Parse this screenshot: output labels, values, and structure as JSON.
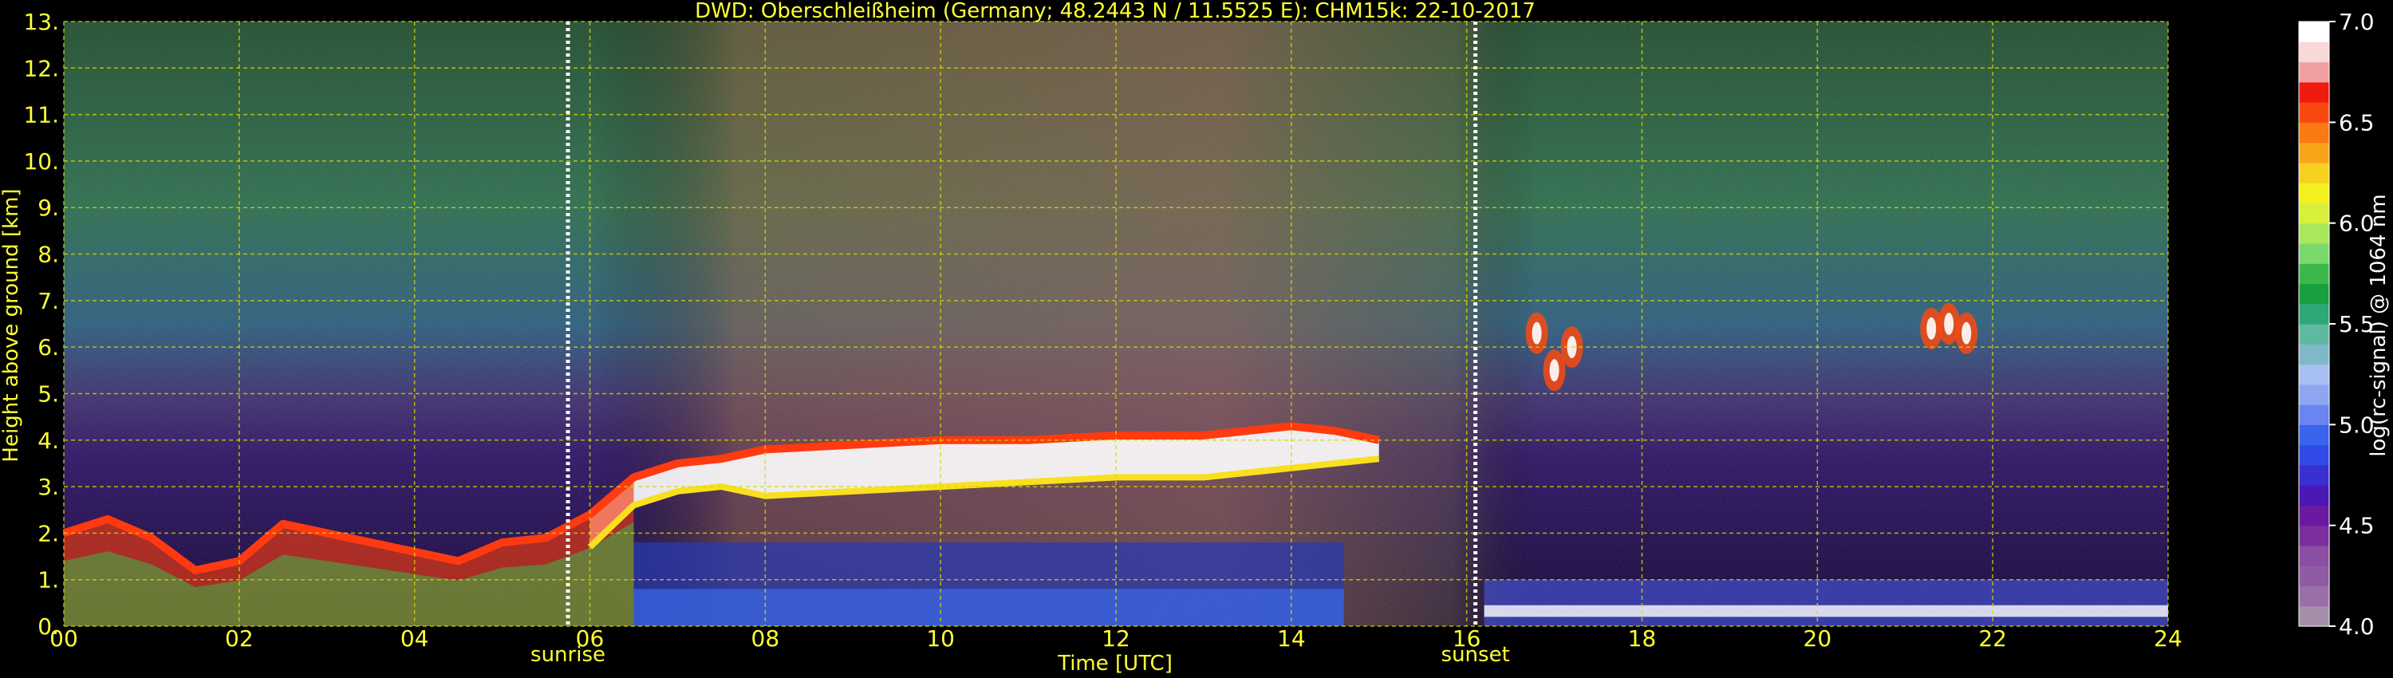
{
  "title": "DWD: Oberschleißheim (Germany; 48.2443 N / 11.5525 E):    CHM15k: 22-10-2017",
  "colors": {
    "background": "#000000",
    "text": "#ffff33",
    "grid": "#d8d800",
    "marker": "#ffffff",
    "colorbar_text": "#ffffff"
  },
  "chart_data": {
    "type": "heatmap",
    "title": "DWD: Oberschleißheim (Germany; 48.2443 N / 11.5525 E):    CHM15k: 22-10-2017",
    "xlabel": "Time [UTC]",
    "ylabel": "Height above ground [km]",
    "xlim": [
      0,
      24
    ],
    "ylim": [
      0,
      13
    ],
    "x_ticks": [
      "00",
      "02",
      "04",
      "06",
      "08",
      "10",
      "12",
      "14",
      "16",
      "18",
      "20",
      "22",
      "24"
    ],
    "y_ticks": [
      "0.",
      "1.",
      "2.",
      "3.",
      "4.",
      "5.",
      "6.",
      "7.",
      "8.",
      "9.",
      "10.",
      "11.",
      "12.",
      "13."
    ],
    "grid": true,
    "annotations": [
      {
        "label": "sunrise",
        "x": 5.75
      },
      {
        "label": "sunset",
        "x": 16.1
      }
    ],
    "colorbar": {
      "label": "log(rc-signal) @ 1064 nm",
      "range": [
        4.0,
        7.0
      ],
      "ticks": [
        "4.0",
        "4.5",
        "5.0",
        "5.5",
        "6.0",
        "6.5",
        "7.0"
      ],
      "colors": [
        "#a48ea8",
        "#9a6fa7",
        "#8f5ca3",
        "#8a4ea2",
        "#7a2f9c",
        "#6a1aa0",
        "#4b17b5",
        "#3a2fd0",
        "#2f4ae6",
        "#3a64ee",
        "#6a84f0",
        "#8ea6f2",
        "#a8bff4",
        "#7fb8c8",
        "#5fb8a0",
        "#2ea878",
        "#18a040",
        "#3cb84a",
        "#7bd86a",
        "#a8e85a",
        "#d8f03c",
        "#f4f020",
        "#f8d020",
        "#f8a418",
        "#f87a10",
        "#f84a10",
        "#f01a10",
        "#f0a0a0",
        "#f8d8d8",
        "#ffffff"
      ]
    },
    "layers": [
      {
        "name": "boundary-layer-top",
        "x": [
          0,
          0.5,
          1,
          1.5,
          2,
          2.5,
          3,
          3.5,
          4,
          4.5,
          5,
          5.5,
          6,
          6.5,
          7,
          7.5,
          8,
          9,
          10,
          11,
          12,
          13,
          14,
          14.5,
          15
        ],
        "y": [
          2.0,
          2.3,
          1.9,
          1.2,
          1.4,
          2.2,
          2.0,
          1.8,
          1.6,
          1.4,
          1.8,
          1.9,
          2.4,
          3.2,
          3.5,
          3.6,
          3.8,
          3.9,
          4.0,
          4.0,
          4.1,
          4.1,
          4.3,
          4.2,
          4.0
        ]
      },
      {
        "name": "boundary-layer-base",
        "x": [
          6,
          6.5,
          7,
          7.5,
          8,
          9,
          10,
          11,
          12,
          13,
          14,
          15
        ],
        "y": [
          1.7,
          2.6,
          2.9,
          3.0,
          2.8,
          2.9,
          3.0,
          3.1,
          3.2,
          3.2,
          3.4,
          3.6
        ]
      },
      {
        "name": "evening-cloud-1",
        "x": [
          16.8,
          17.0,
          17.2
        ],
        "y": [
          6.3,
          5.5,
          6.0
        ]
      },
      {
        "name": "evening-cloud-2",
        "x": [
          21.3,
          21.5,
          21.7
        ],
        "y": [
          6.4,
          6.5,
          6.3
        ]
      }
    ]
  }
}
